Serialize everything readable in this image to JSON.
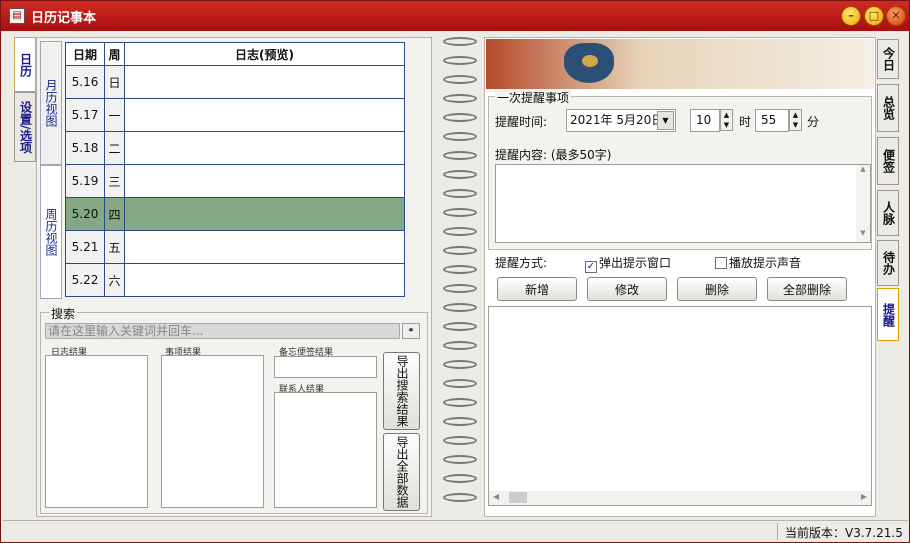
{
  "window": {
    "title": "日历记事本"
  },
  "left_tabs": [
    {
      "label": "日历"
    },
    {
      "label": "设置/选项"
    }
  ],
  "view_tabs": [
    {
      "label": "月历视图"
    },
    {
      "label": "周历视图"
    }
  ],
  "calendar": {
    "headers": [
      "日期",
      "周",
      "日志(预览)"
    ],
    "rows": [
      {
        "date": "5.16",
        "weekday": "日",
        "log": ""
      },
      {
        "date": "5.17",
        "weekday": "一",
        "log": ""
      },
      {
        "date": "5.18",
        "weekday": "二",
        "log": ""
      },
      {
        "date": "5.19",
        "weekday": "三",
        "log": ""
      },
      {
        "date": "5.20",
        "weekday": "四",
        "log": ""
      },
      {
        "date": "5.21",
        "weekday": "五",
        "log": ""
      },
      {
        "date": "5.22",
        "weekday": "六",
        "log": ""
      }
    ]
  },
  "search": {
    "title": "搜索",
    "placeholder": "请在这里输入关键词并回车...",
    "log_results": "日志结果",
    "event_results": "事项结果",
    "memo_results": "备忘便签结果",
    "contact_results": "联系人结果",
    "export_results": "导出搜索结果",
    "export_all": "导出全部数据"
  },
  "reminder": {
    "section_title": "一次提醒事项",
    "time_label": "提醒时间:",
    "date_value": "2021年  5月20日",
    "hour_value": "10",
    "hour_unit": "时",
    "minute_value": "55",
    "minute_unit": "分",
    "content_label": "提醒内容:  (最多50字)",
    "method_label": "提醒方式:",
    "popup_label": "弹出提示窗口",
    "popup_checked": true,
    "sound_label": "播放提示声音",
    "sound_checked": false,
    "buttons": {
      "add": "新增",
      "edit": "修改",
      "delete": "删除",
      "delete_all": "全部删除"
    }
  },
  "right_tabs": [
    {
      "label": "今日"
    },
    {
      "label": "总览"
    },
    {
      "label": "便签"
    },
    {
      "label": "人脉"
    },
    {
      "label": "待办"
    },
    {
      "label": "提醒"
    }
  ],
  "status": {
    "version": "当前版本：V3.7.21.5"
  },
  "colors": {
    "titlebar": "#c0191a",
    "selected_row": "#84a884",
    "grid": "#2a4a88"
  }
}
